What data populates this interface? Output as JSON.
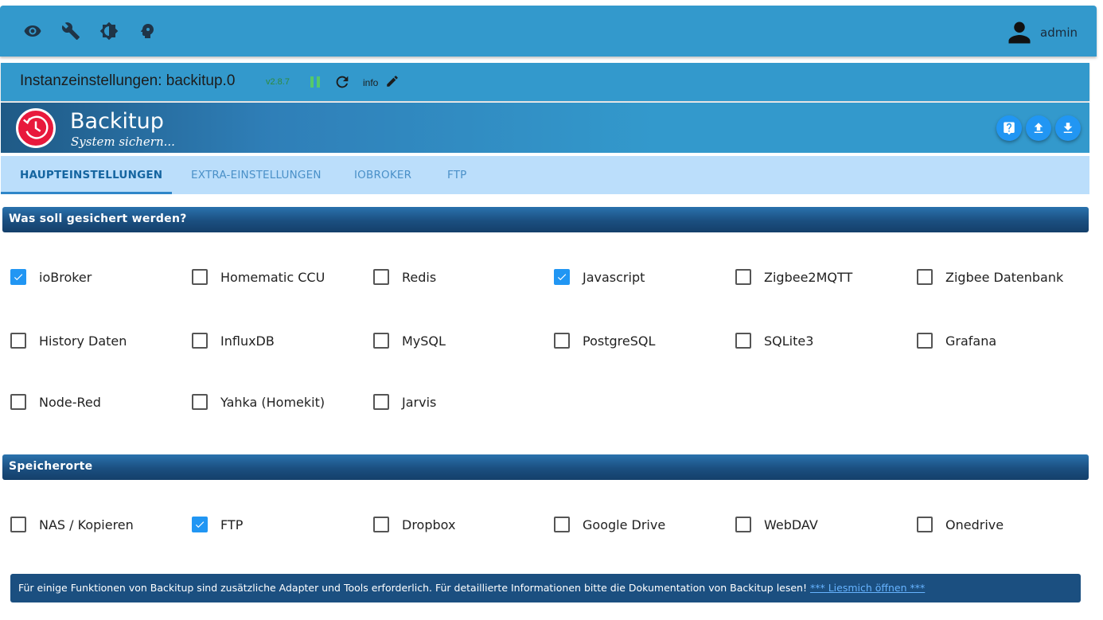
{
  "topbar": {
    "icons": [
      "eye-icon",
      "wrench-icon",
      "brightness-icon",
      "head-icon"
    ],
    "user": "admin"
  },
  "instance": {
    "title": "Instanzeinstellungen: backitup.0",
    "version": "v2.8.7",
    "info_label": "info"
  },
  "banner": {
    "name": "Backitup",
    "subtitle": "System sichern..."
  },
  "tabs": [
    {
      "label": "HAUPTEINSTELLUNGEN",
      "active": true
    },
    {
      "label": "EXTRA-EINSTELLUNGEN",
      "active": false
    },
    {
      "label": "IOBROKER",
      "active": false
    },
    {
      "label": "FTP",
      "active": false
    }
  ],
  "sections": {
    "backup_title": "Was soll gesichert werden?",
    "storage_title": "Speicherorte"
  },
  "backup_items": [
    {
      "label": "ioBroker",
      "checked": true
    },
    {
      "label": "Homematic CCU",
      "checked": false
    },
    {
      "label": "Redis",
      "checked": false
    },
    {
      "label": "Javascript",
      "checked": true
    },
    {
      "label": "Zigbee2MQTT",
      "checked": false
    },
    {
      "label": "Zigbee Datenbank",
      "checked": false
    },
    {
      "label": "History Daten",
      "checked": false
    },
    {
      "label": "InfluxDB",
      "checked": false
    },
    {
      "label": "MySQL",
      "checked": false
    },
    {
      "label": "PostgreSQL",
      "checked": false
    },
    {
      "label": "SQLite3",
      "checked": false
    },
    {
      "label": "Grafana",
      "checked": false
    },
    {
      "label": "Node-Red",
      "checked": false
    },
    {
      "label": "Yahka (Homekit)",
      "checked": false
    },
    {
      "label": "Jarvis",
      "checked": false
    }
  ],
  "storage_items": [
    {
      "label": "NAS / Kopieren",
      "checked": false
    },
    {
      "label": "FTP",
      "checked": true
    },
    {
      "label": "Dropbox",
      "checked": false
    },
    {
      "label": "Google Drive",
      "checked": false
    },
    {
      "label": "WebDAV",
      "checked": false
    },
    {
      "label": "Onedrive",
      "checked": false
    }
  ],
  "note": {
    "text": "Für einige Funktionen von Backitup sind zusätzliche Adapter und Tools erforderlich. Für detaillierte Informationen bitte die Dokumentation von Backitup lesen! ",
    "link": "*** Liesmich öffnen ***"
  },
  "colors": {
    "primary": "#3399cc",
    "tabs_bg": "#bbdefb",
    "section_bg": "#1b4f80",
    "checkbox_on": "#2196f3",
    "logo_red": "#e8193c",
    "version_green": "#2e8b3d"
  }
}
